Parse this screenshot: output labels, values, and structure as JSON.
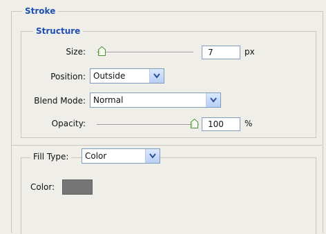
{
  "stroke": {
    "legend": "Stroke"
  },
  "structure": {
    "legend": "Structure",
    "size": {
      "label": "Size:",
      "value": "7",
      "unit": "px",
      "slider_fraction": 0.04
    },
    "position": {
      "label": "Position:",
      "value": "Outside"
    },
    "blend_mode": {
      "label": "Blend Mode:",
      "value": "Normal"
    },
    "opacity": {
      "label": "Opacity:",
      "value": "100",
      "unit": "%",
      "slider_fraction": 1.0
    }
  },
  "fill": {
    "type_label": "Fill Type:",
    "type_value": "Color",
    "color_label": "Color:",
    "color_hex": "#757575"
  },
  "icons": [
    "slider-thumb-icon",
    "chevron-down-icon"
  ]
}
